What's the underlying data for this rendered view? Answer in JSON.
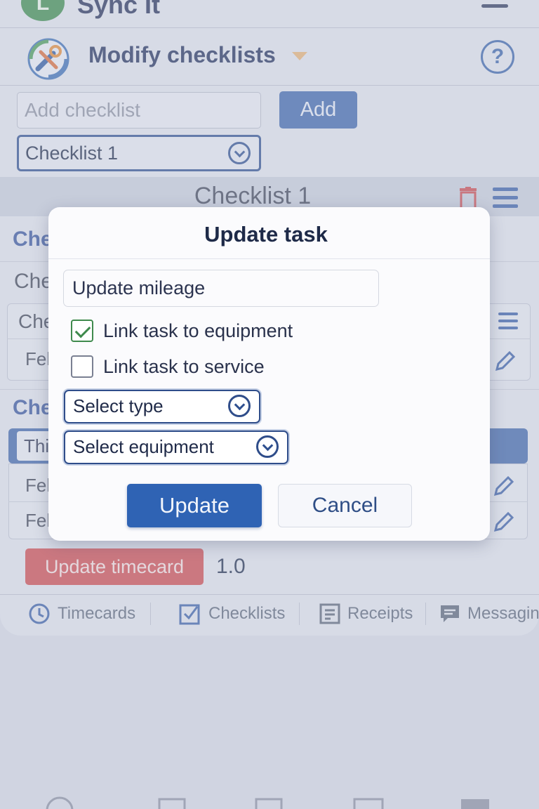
{
  "app": {
    "logo_letter": "L",
    "title": "Sync It"
  },
  "header": {
    "title": "Modify checklists"
  },
  "add_checklist": {
    "placeholder": "Add checklist",
    "button": "Add"
  },
  "checklist_select": {
    "value": "Checklist 1"
  },
  "section": {
    "title": "Checklist 1"
  },
  "background": {
    "heading_a": "Che",
    "text_b": "Che",
    "row_c": "Che",
    "row_d": "Fel",
    "heading_e": "Che",
    "row_f": "Thi",
    "row_g": "Fel",
    "row_h": "Fel"
  },
  "timecard": {
    "button": "Update timecard",
    "value": "1.0"
  },
  "tabs": [
    {
      "label": "Timecards",
      "icon": "clock-icon"
    },
    {
      "label": "Checklists",
      "icon": "checkbox-icon"
    },
    {
      "label": "Receipts",
      "icon": "receipt-icon"
    },
    {
      "label": "Messaging",
      "icon": "chat-icon"
    }
  ],
  "modal": {
    "title": "Update task",
    "task_value": "Update mileage",
    "link_equipment": {
      "label": "Link task to equipment",
      "checked": true
    },
    "link_service": {
      "label": "Link task to service",
      "checked": false
    },
    "select_type": "Select type",
    "select_equipment": "Select equipment",
    "update_button": "Update",
    "cancel_button": "Cancel"
  },
  "colors": {
    "primary": "#2f63b4",
    "danger": "#cd4a4f",
    "success": "#3f8a4d",
    "accent": "#e5b176"
  }
}
